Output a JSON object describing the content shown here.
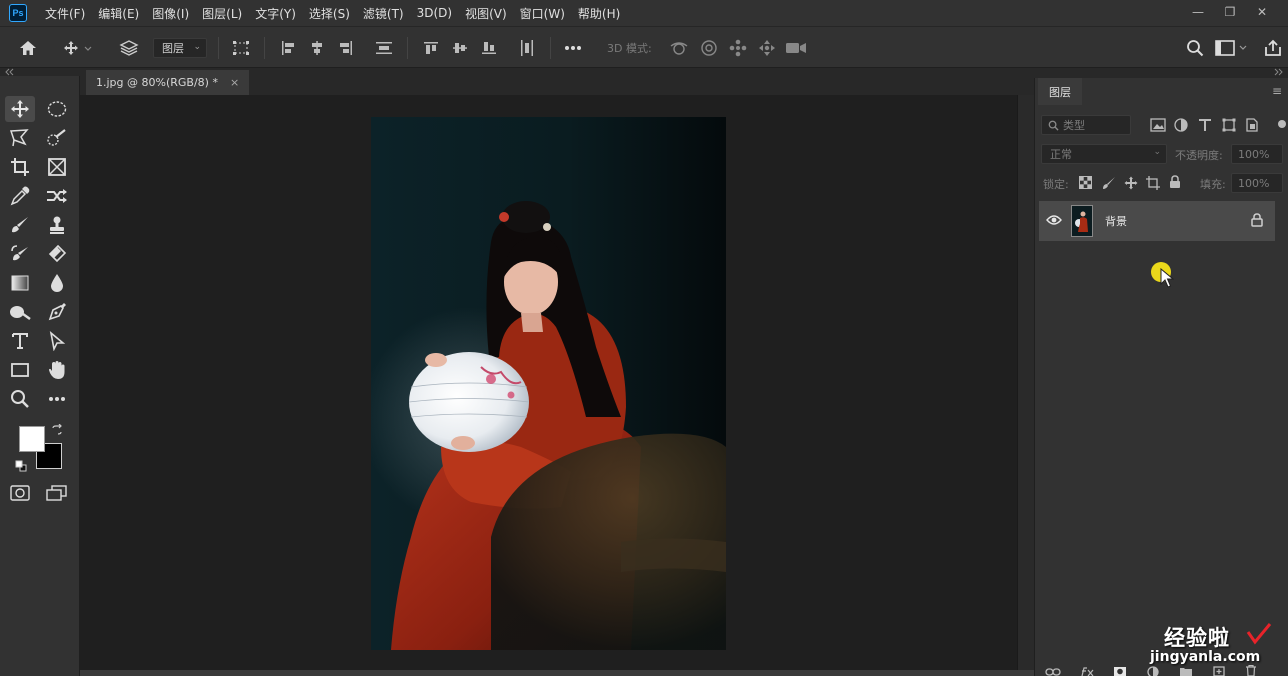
{
  "app": {
    "logo": "Ps"
  },
  "menu": {
    "items": [
      "文件(F)",
      "编辑(E)",
      "图像(I)",
      "图层(L)",
      "文字(Y)",
      "选择(S)",
      "滤镜(T)",
      "3D(D)",
      "视图(V)",
      "窗口(W)",
      "帮助(H)"
    ]
  },
  "window_controls": {
    "minimize": "—",
    "restore": "❐",
    "close": "✕"
  },
  "options_bar": {
    "auto_select_target": "图层",
    "mode_label": "3D 模式:"
  },
  "document": {
    "tab_title": "1.jpg @ 80%(RGB/8) *",
    "tab_close": "×"
  },
  "colors": {
    "foreground": "#ffffff",
    "background": "#000000"
  },
  "layers_panel": {
    "tab_label": "图层",
    "filter_placeholder": "类型",
    "blend_mode": "正常",
    "opacity_label": "不透明度:",
    "opacity_value": "100%",
    "lock_label": "锁定:",
    "fill_label": "填充:",
    "fill_value": "100%",
    "layers": [
      {
        "name": "背景",
        "visible": true,
        "locked": true
      }
    ]
  },
  "watermark": {
    "title": "经验啦",
    "url": "jingyanla.com"
  }
}
